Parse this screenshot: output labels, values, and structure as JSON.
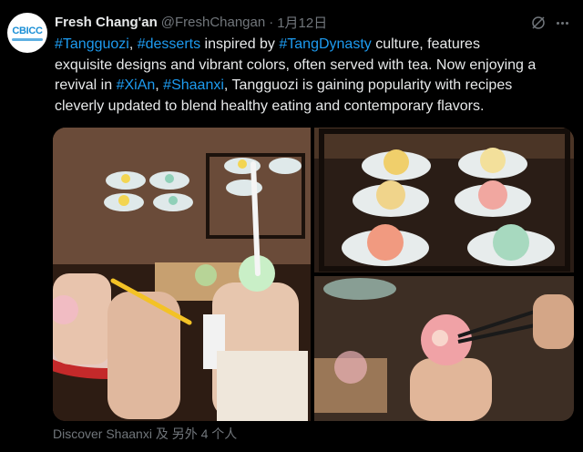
{
  "account": {
    "display_name": "Fresh Chang'an",
    "handle": "@FreshChangan",
    "separator": "·",
    "date": "1月12日",
    "avatar_text": "CBICC"
  },
  "tweet": {
    "lines": [
      [
        {
          "text": "#Tangguozi",
          "link": true
        },
        {
          "text": ", ",
          "link": false
        },
        {
          "text": "#desserts",
          "link": true
        },
        {
          "text": " inspired by ",
          "link": false
        },
        {
          "text": "#TangDynasty",
          "link": true
        },
        {
          "text": " culture, features",
          "link": false
        }
      ],
      [
        {
          "text": "exquisite designs and vibrant colors, often served with tea. Now enjoying a",
          "link": false
        }
      ],
      [
        {
          "text": "revival in ",
          "link": false
        },
        {
          "text": "#XiAn",
          "link": true
        },
        {
          "text": ", ",
          "link": false
        },
        {
          "text": "#Shaanxi",
          "link": true
        },
        {
          "text": ", Tangguozi is gaining popularity with recipes",
          "link": false
        }
      ],
      [
        {
          "text": "cleverly updated to blend healthy eating and contemporary flavors.",
          "link": false
        }
      ]
    ]
  },
  "media_caption": "Discover Shaanxi 及 另外 4 个人",
  "colors": {
    "background": "#000000",
    "text": "#e7e9ea",
    "link": "#1d9bf0",
    "muted": "#71767b"
  },
  "icons": [
    "grok-icon",
    "more-icon"
  ]
}
